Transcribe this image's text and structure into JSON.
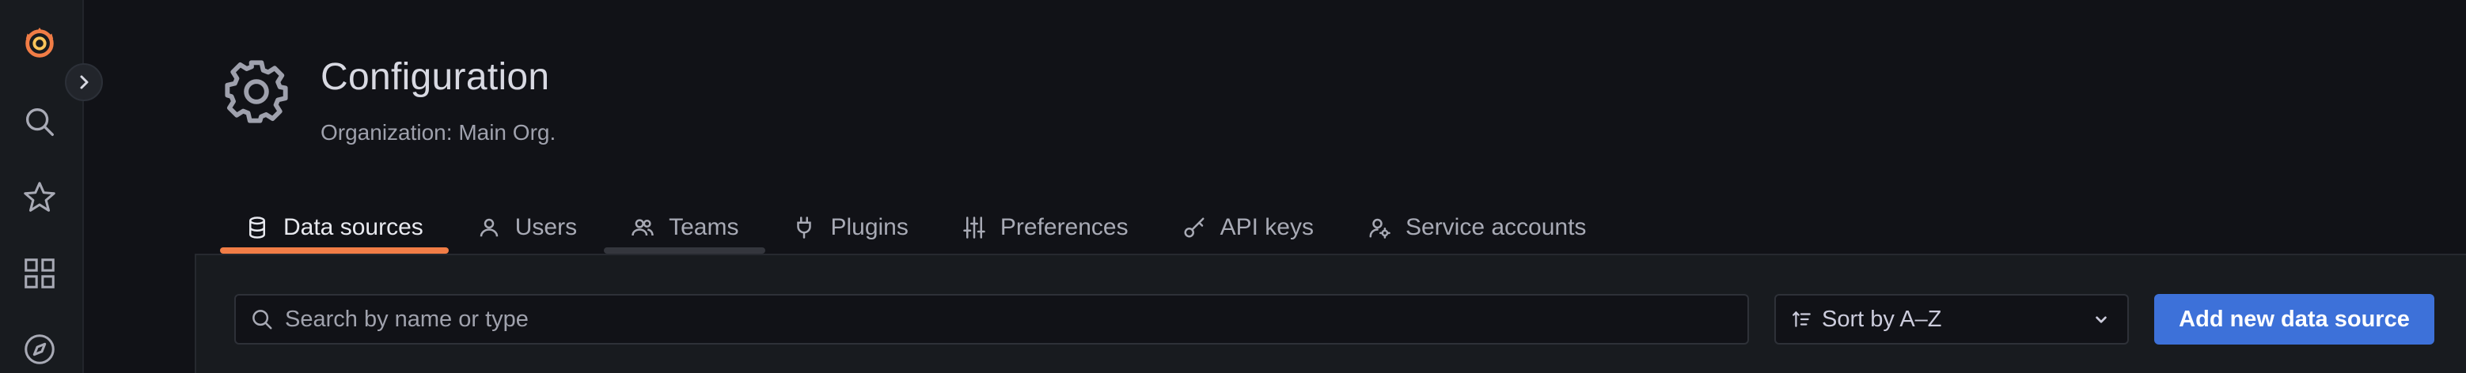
{
  "sidebar": {
    "icons": [
      "grafana-logo-icon",
      "search-icon",
      "star-icon",
      "dashboards-icon",
      "explore-compass-icon"
    ],
    "expand_icon": "chevron-right-icon",
    "logo_color": "#f17d46"
  },
  "header": {
    "icon": "gear-icon",
    "title": "Configuration",
    "subtitle": "Organization: Main Org."
  },
  "tabs": [
    {
      "label": "Data sources",
      "icon": "database-icon",
      "active": true
    },
    {
      "label": "Users",
      "icon": "user-icon",
      "active": false
    },
    {
      "label": "Teams",
      "icon": "users-icon",
      "active": false,
      "hover": true
    },
    {
      "label": "Plugins",
      "icon": "plug-icon",
      "active": false
    },
    {
      "label": "Preferences",
      "icon": "sliders-icon",
      "active": false
    },
    {
      "label": "API keys",
      "icon": "key-icon",
      "active": false
    },
    {
      "label": "Service accounts",
      "icon": "user-cog-icon",
      "active": false
    }
  ],
  "toolbar": {
    "search_placeholder": "Search by name or type",
    "search_value": "",
    "sort_label": "Sort by A–Z",
    "add_label": "Add new data source"
  },
  "colors": {
    "accent": "#f17d46",
    "primary_button": "#3d71d9",
    "background": "#111217"
  }
}
